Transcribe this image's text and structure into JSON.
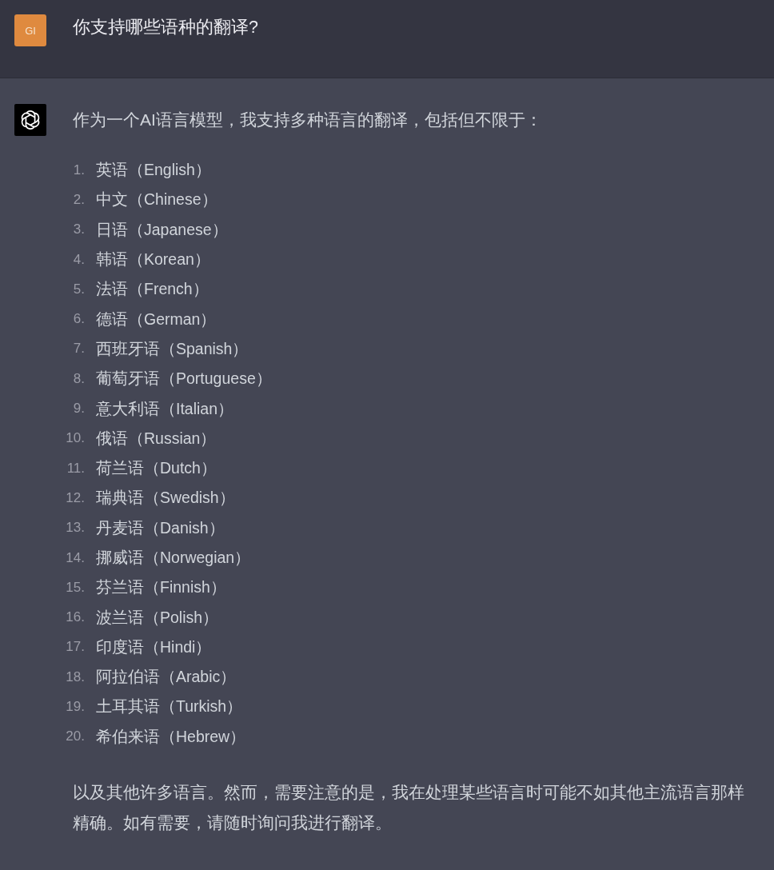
{
  "user_message": {
    "avatar_initials": "GI",
    "text": "你支持哪些语种的翻译?"
  },
  "assistant_message": {
    "intro": "作为一个AI语言模型，我支持多种语言的翻译，包括但不限于：",
    "list": [
      {
        "number": "1.",
        "text": "英语（English）"
      },
      {
        "number": "2.",
        "text": "中文（Chinese）"
      },
      {
        "number": "3.",
        "text": "日语（Japanese）"
      },
      {
        "number": "4.",
        "text": "韩语（Korean）"
      },
      {
        "number": "5.",
        "text": "法语（French）"
      },
      {
        "number": "6.",
        "text": "德语（German）"
      },
      {
        "number": "7.",
        "text": "西班牙语（Spanish）"
      },
      {
        "number": "8.",
        "text": "葡萄牙语（Portuguese）"
      },
      {
        "number": "9.",
        "text": "意大利语（Italian）"
      },
      {
        "number": "10.",
        "text": "俄语（Russian）"
      },
      {
        "number": "11.",
        "text": "荷兰语（Dutch）"
      },
      {
        "number": "12.",
        "text": "瑞典语（Swedish）"
      },
      {
        "number": "13.",
        "text": "丹麦语（Danish）"
      },
      {
        "number": "14.",
        "text": "挪威语（Norwegian）"
      },
      {
        "number": "15.",
        "text": "芬兰语（Finnish）"
      },
      {
        "number": "16.",
        "text": "波兰语（Polish）"
      },
      {
        "number": "17.",
        "text": "印度语（Hindi）"
      },
      {
        "number": "18.",
        "text": "阿拉伯语（Arabic）"
      },
      {
        "number": "19.",
        "text": "土耳其语（Turkish）"
      },
      {
        "number": "20.",
        "text": "希伯来语（Hebrew）"
      }
    ],
    "closing": "以及其他许多语言。然而，需要注意的是，我在处理某些语言时可能不如其他主流语言那样精确。如有需要，请随时询问我进行翻译。"
  }
}
